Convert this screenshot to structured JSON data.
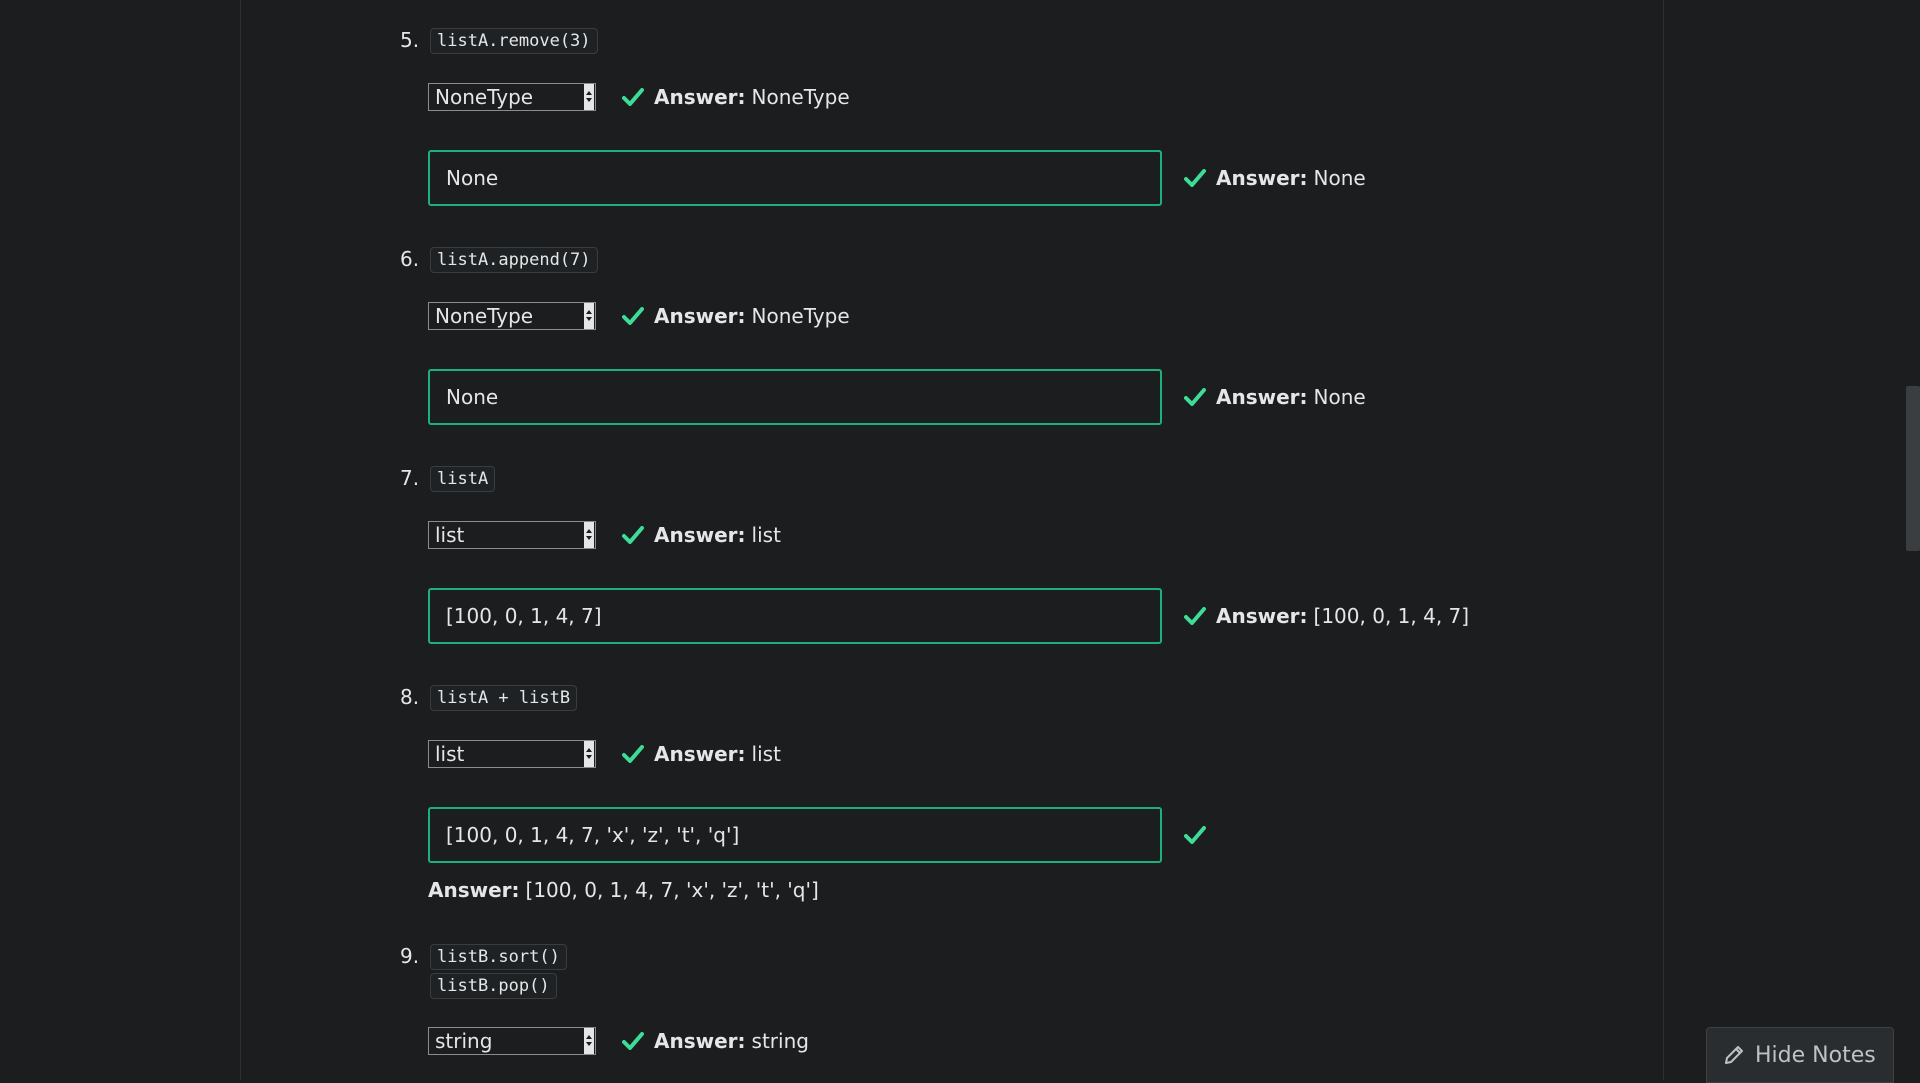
{
  "questions": [
    {
      "num": "5.",
      "code": [
        "listA.remove(3)"
      ],
      "type_value": "NoneType",
      "type_answer": "NoneType",
      "value": "None",
      "value_answer": "None"
    },
    {
      "num": "6.",
      "code": [
        "listA.append(7)"
      ],
      "type_value": "NoneType",
      "type_answer": "NoneType",
      "value": "None",
      "value_answer": "None"
    },
    {
      "num": "7.",
      "code": [
        "listA"
      ],
      "type_value": "list",
      "type_answer": "list",
      "value": "[100, 0, 1, 4, 7]",
      "value_answer": "[100, 0, 1, 4, 7]"
    },
    {
      "num": "8.",
      "code": [
        "listA + listB"
      ],
      "type_value": "list",
      "type_answer": "list",
      "value": "[100, 0, 1, 4, 7, 'x', 'z', 't', 'q']",
      "value_answer": "[100, 0, 1, 4, 7, 'x', 'z', 't', 'q']"
    },
    {
      "num": "9.",
      "code": [
        "listB.sort()",
        "listB.pop()"
      ],
      "type_value": "string",
      "type_answer": "string"
    }
  ],
  "labels": {
    "answer": "Answer:"
  },
  "notes_button": {
    "label": "Hide Notes",
    "icon": "pencil-icon"
  },
  "colors": {
    "accent": "#1db07a",
    "check": "#3ddc97",
    "background": "#1b1d1f"
  }
}
